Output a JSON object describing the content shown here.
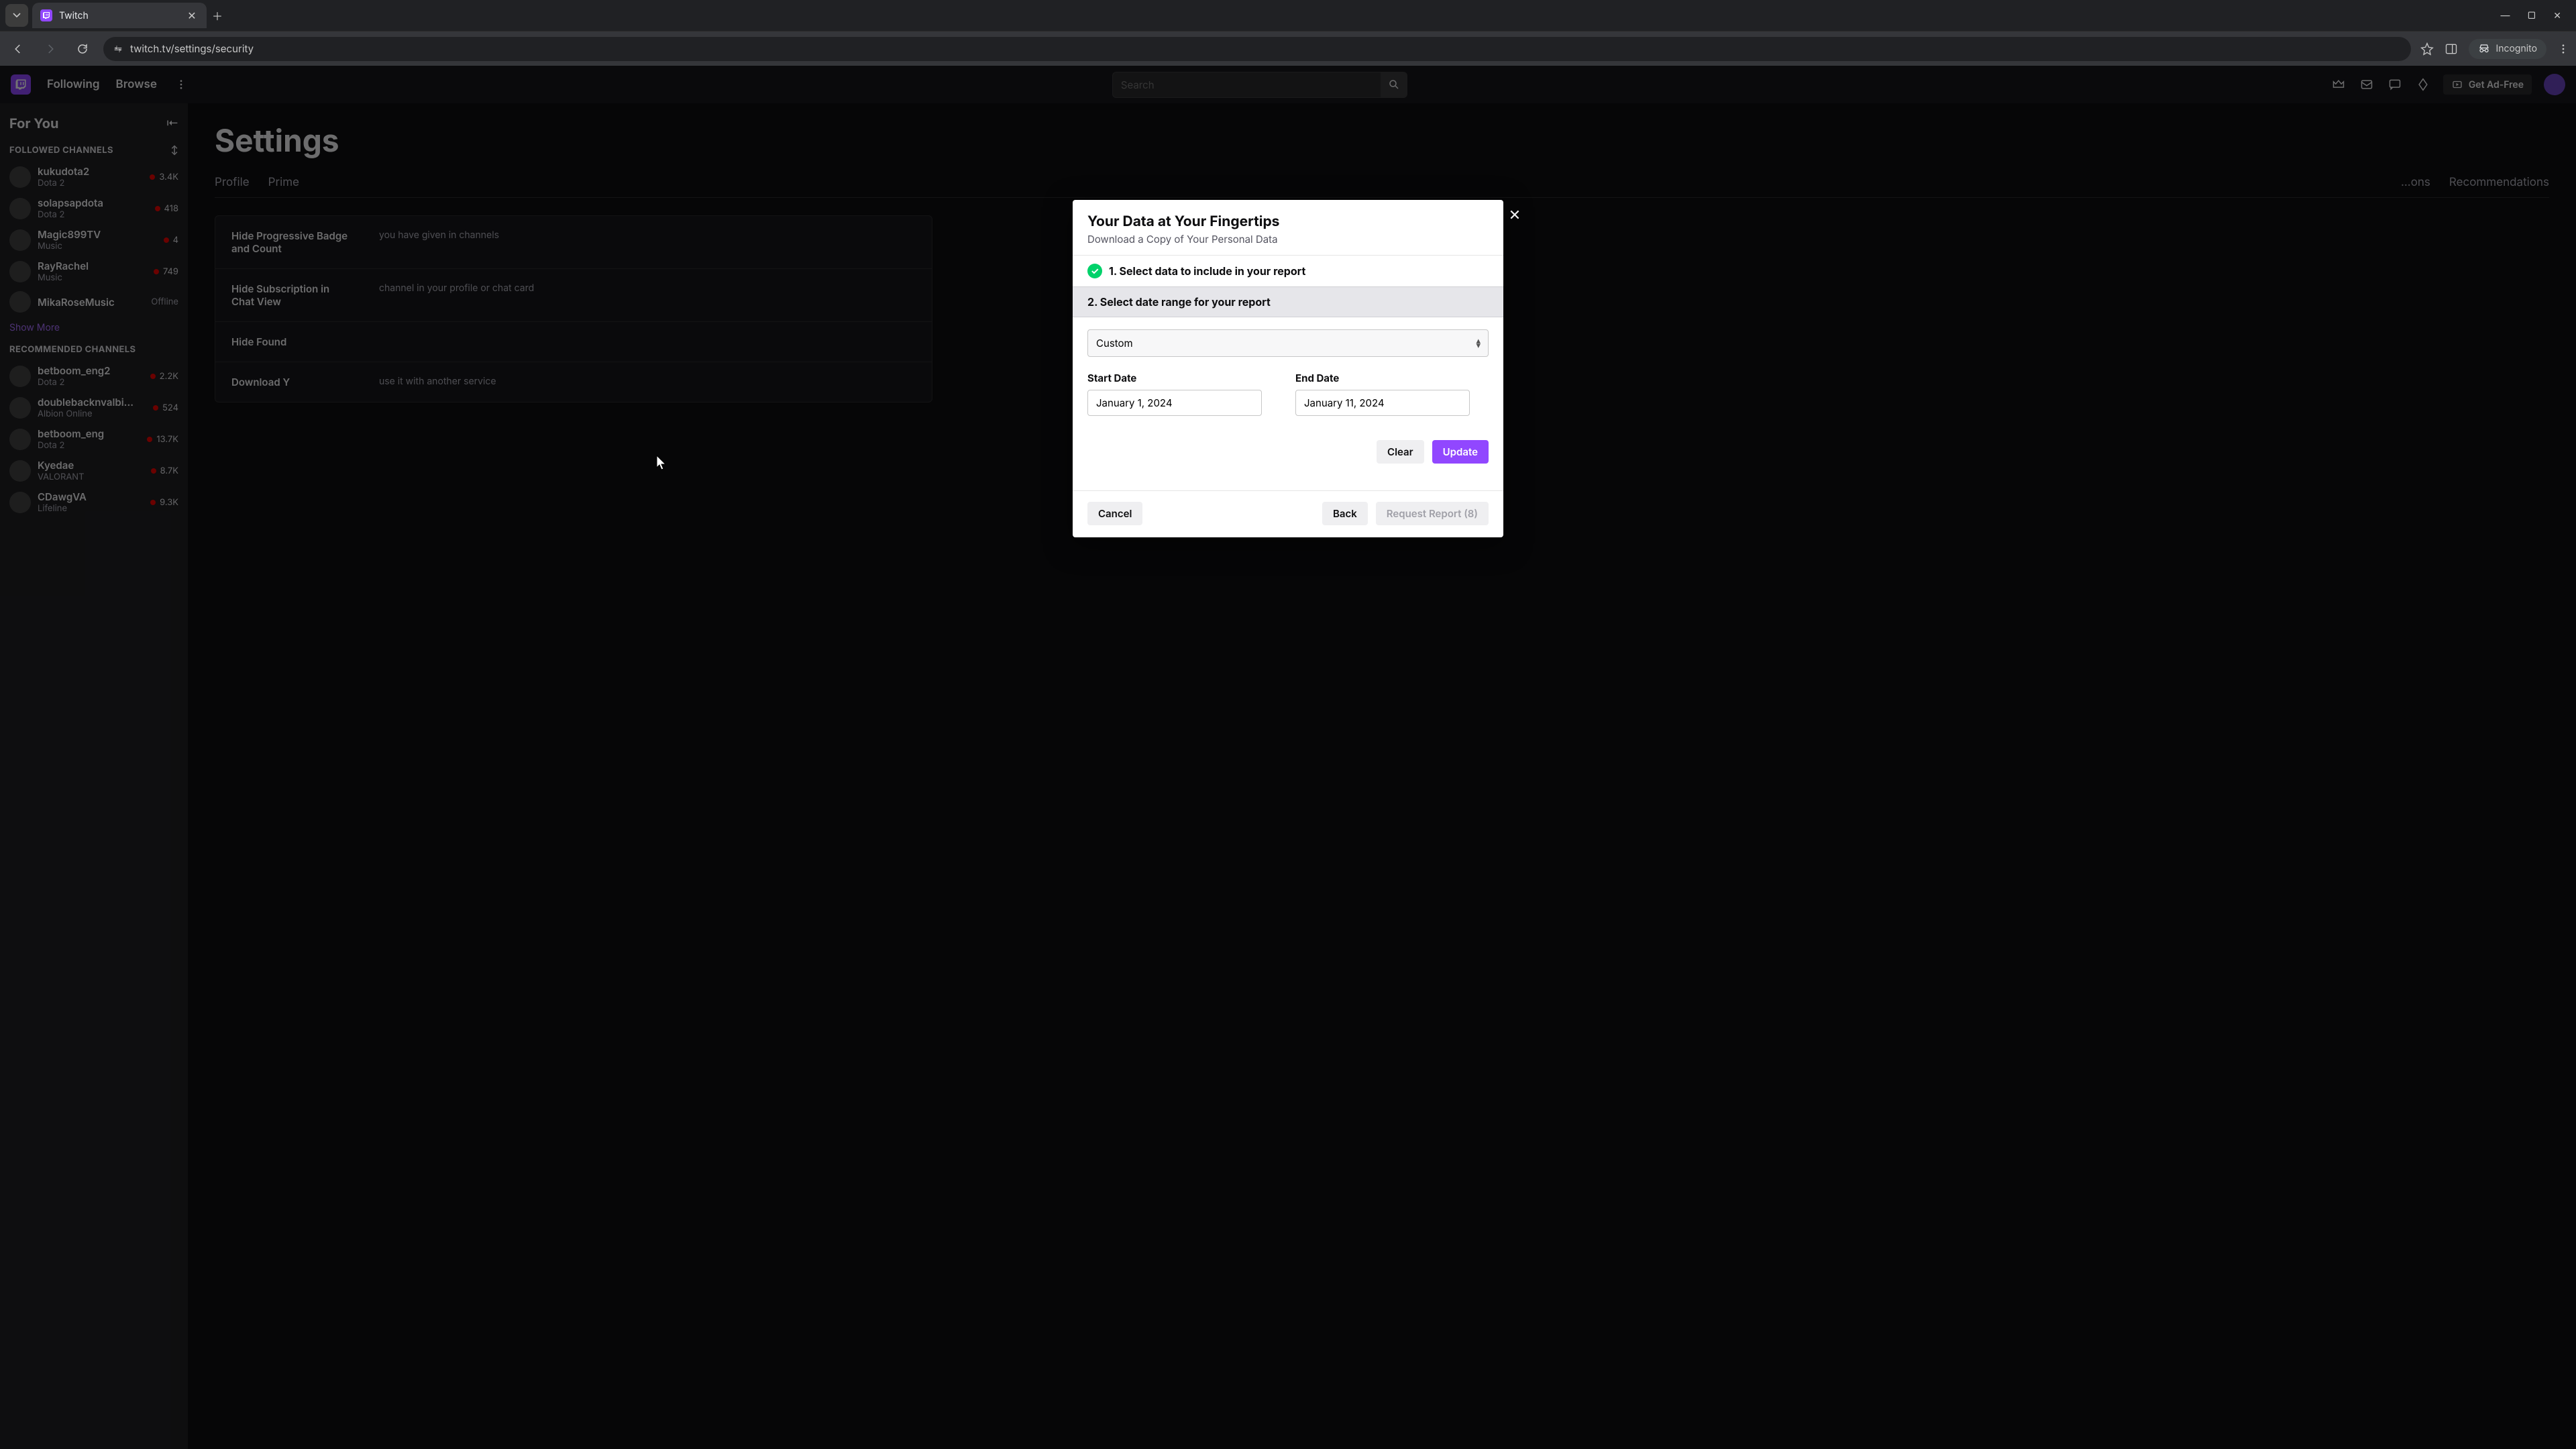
{
  "browser": {
    "tab_title": "Twitch",
    "url": "twitch.tv/settings/security",
    "incognito_label": "Incognito"
  },
  "topnav": {
    "following": "Following",
    "browse": "Browse",
    "search_placeholder": "Search",
    "ad_free": "Get Ad-Free"
  },
  "sidebar": {
    "for_you": "For You",
    "followed_title": "FOLLOWED CHANNELS",
    "recommended_title": "RECOMMENDED CHANNELS",
    "show_more": "Show More",
    "followed": [
      {
        "name": "kukudota2",
        "game": "Dota 2",
        "viewers": "3.4K",
        "live": true
      },
      {
        "name": "solapsapdota",
        "game": "Dota 2",
        "viewers": "418",
        "live": true
      },
      {
        "name": "Magic899TV",
        "game": "Music",
        "viewers": "4",
        "live": true
      },
      {
        "name": "RayRachel",
        "game": "Music",
        "viewers": "749",
        "live": true
      },
      {
        "name": "MikaRoseMusic",
        "game": "",
        "viewers": "Offline",
        "live": false
      }
    ],
    "recommended": [
      {
        "name": "betboom_eng2",
        "game": "Dota 2",
        "viewers": "2.2K",
        "live": true
      },
      {
        "name": "doublebacknvalbi...",
        "game": "Albion Online",
        "viewers": "524",
        "live": true
      },
      {
        "name": "betboom_eng",
        "game": "Dota 2",
        "viewers": "13.7K",
        "live": true
      },
      {
        "name": "Kyedae",
        "game": "VALORANT",
        "viewers": "8.7K",
        "live": true
      },
      {
        "name": "CDawgVA",
        "game": "Lifeline",
        "viewers": "9.3K",
        "live": true
      }
    ]
  },
  "main": {
    "title": "Settings",
    "tabs": {
      "profile": "Profile",
      "prime": "Prime",
      "more": "...ons",
      "recommendations": "Recommendations"
    },
    "rows": {
      "r1_label": "Hide Progressive Badge and Count",
      "r1_desc": "you have given in channels",
      "r2_label": "Hide Subscription in Chat View",
      "r2_desc": "channel in your profile or chat card",
      "r3_label": "Hide Found",
      "r4_label": "Download Y",
      "r4_desc": "use it with another service"
    }
  },
  "modal": {
    "title": "Your Data at Your Fingertips",
    "subtitle": "Download a Copy of Your Personal Data",
    "step1": "1. Select data to include in your report",
    "step2": "2. Select date range for your report",
    "range_value": "Custom",
    "start_label": "Start Date",
    "start_value": "January 1, 2024",
    "end_label": "End Date",
    "end_value": "January 11, 2024",
    "clear": "Clear",
    "update": "Update",
    "cancel": "Cancel",
    "back": "Back",
    "request": "Request Report (8)"
  }
}
